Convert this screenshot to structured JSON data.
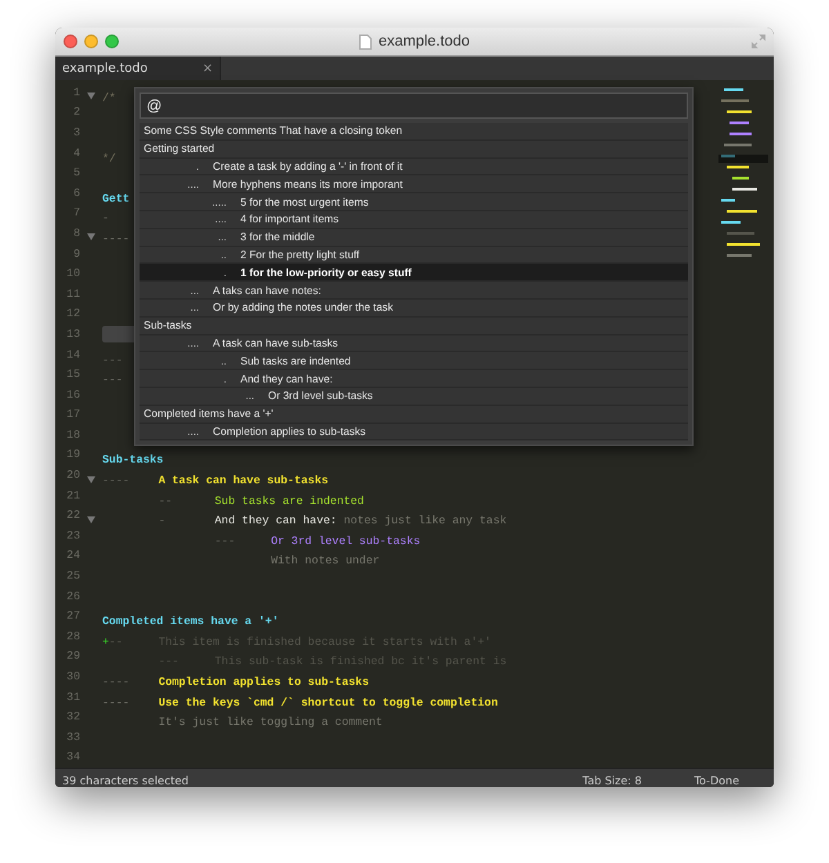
{
  "window": {
    "title": "example.todo"
  },
  "tabs": [
    {
      "label": "example.todo",
      "close": "×",
      "selected": true
    }
  ],
  "editor": {
    "lines": [
      {
        "number": "1",
        "fold": true,
        "current": false,
        "segments": [
          {
            "kind": "comment",
            "text": "/*"
          }
        ]
      },
      {
        "number": "2",
        "fold": false,
        "current": false
      },
      {
        "number": "3",
        "fold": false,
        "current": false
      },
      {
        "number": "4",
        "fold": false,
        "current": false,
        "segments": [
          {
            "kind": "comment",
            "text": "*/"
          }
        ]
      },
      {
        "number": "5",
        "fold": false,
        "current": false
      },
      {
        "number": "6",
        "fold": false,
        "current": false,
        "segments": [
          {
            "kind": "heading",
            "text": "Gett"
          }
        ]
      },
      {
        "number": "7",
        "fold": false,
        "current": false,
        "segments": [
          {
            "kind": "dashes",
            "text": "-"
          }
        ]
      },
      {
        "number": "8",
        "fold": true,
        "current": false,
        "segments": [
          {
            "kind": "dashes",
            "text": "----"
          }
        ]
      },
      {
        "number": "9",
        "fold": false,
        "current": false
      },
      {
        "number": "10",
        "fold": false,
        "current": false
      },
      {
        "number": "11",
        "fold": false,
        "current": false
      },
      {
        "number": "12",
        "fold": false,
        "current": false
      },
      {
        "number": "13",
        "fold": false,
        "current": true
      },
      {
        "number": "14",
        "fold": false,
        "current": false,
        "segments": [
          {
            "kind": "dashes",
            "text": "---"
          }
        ]
      },
      {
        "number": "15",
        "fold": false,
        "current": false,
        "segments": [
          {
            "kind": "dashes",
            "text": "---"
          }
        ]
      },
      {
        "number": "16",
        "fold": false,
        "current": false
      },
      {
        "number": "17",
        "fold": false,
        "current": false
      },
      {
        "number": "18",
        "fold": false,
        "current": false
      },
      {
        "number": "19",
        "fold": false,
        "current": false,
        "segments": [
          {
            "kind": "heading",
            "text": "Sub-tasks"
          }
        ]
      },
      {
        "number": "20",
        "fold": true,
        "current": false,
        "segments": [
          {
            "kind": "dashes",
            "text": "----\t"
          },
          {
            "kind": "urgent",
            "text": "A task can have sub-tasks"
          }
        ]
      },
      {
        "number": "21",
        "fold": false,
        "current": false,
        "segments": [
          {
            "kind": "dashes",
            "text": "\t--\t"
          },
          {
            "kind": "light",
            "text": "Sub tasks are indented"
          }
        ]
      },
      {
        "number": "22",
        "fold": true,
        "current": false,
        "segments": [
          {
            "kind": "dashes",
            "text": "\t-\t"
          },
          {
            "kind": "task",
            "text": "And they can have:"
          },
          {
            "kind": "note",
            "text": " notes just like any task"
          }
        ]
      },
      {
        "number": "23",
        "fold": false,
        "current": false,
        "segments": [
          {
            "kind": "dashes",
            "text": "\t\t---\t"
          },
          {
            "kind": "middle",
            "text": "Or 3rd level sub-tasks"
          }
        ]
      },
      {
        "number": "24",
        "fold": false,
        "current": false,
        "segments": [
          {
            "kind": "note",
            "text": "\t\t\tWith notes under"
          }
        ]
      },
      {
        "number": "25",
        "fold": false,
        "current": false
      },
      {
        "number": "26",
        "fold": false,
        "current": false
      },
      {
        "number": "27",
        "fold": false,
        "current": false,
        "segments": [
          {
            "kind": "heading",
            "text": "Completed items have a '+'"
          }
        ]
      },
      {
        "number": "28",
        "fold": false,
        "current": false,
        "segments": [
          {
            "kind": "plus",
            "text": "+"
          },
          {
            "kind": "done",
            "text": "--\tThis item is finished because it starts with a'+'"
          }
        ]
      },
      {
        "number": "29",
        "fold": false,
        "current": false,
        "segments": [
          {
            "kind": "done",
            "text": "\t---\tThis sub-task is finished bc it's parent is"
          }
        ]
      },
      {
        "number": "30",
        "fold": false,
        "current": false,
        "segments": [
          {
            "kind": "dashes",
            "text": "----\t"
          },
          {
            "kind": "urgent",
            "text": "Completion applies to sub-tasks"
          }
        ]
      },
      {
        "number": "31",
        "fold": false,
        "current": false,
        "segments": [
          {
            "kind": "dashes",
            "text": "----\t"
          },
          {
            "kind": "urgent",
            "text": "Use the keys `cmd /` shortcut to toggle completion"
          }
        ]
      },
      {
        "number": "32",
        "fold": false,
        "current": false,
        "segments": [
          {
            "kind": "note",
            "text": "\tIt's just like toggling a comment"
          }
        ]
      },
      {
        "number": "33",
        "fold": false,
        "current": false
      },
      {
        "number": "34",
        "fold": false,
        "current": false
      }
    ]
  },
  "goto_symbol": {
    "query": "@",
    "items": [
      {
        "text": "Some CSS Style comments That have a closing token",
        "selected": false
      },
      {
        "text": "Getting started",
        "selected": false,
        "children": [
          {
            "marker": ".",
            "text": "Create a task by adding a '-' in front of it",
            "selected": false
          },
          {
            "marker": "....",
            "text": "More hyphens means its more imporant",
            "selected": false,
            "children": [
              {
                "marker": ".....",
                "text": "5 for the most urgent items",
                "selected": false
              },
              {
                "marker": "....",
                "text": "4 for important items",
                "selected": false
              },
              {
                "marker": "...",
                "text": "3 for the middle",
                "selected": false
              },
              {
                "marker": "..",
                "text": "2 For the pretty light stuff",
                "selected": false
              },
              {
                "marker": ".",
                "text": "1 for the low-priority or easy stuff",
                "selected": true
              }
            ]
          },
          {
            "marker": "...",
            "text": "A taks can have notes:",
            "selected": false
          },
          {
            "marker": "...",
            "text": "Or by adding the notes under the task",
            "selected": false
          }
        ]
      },
      {
        "text": "Sub-tasks",
        "selected": false,
        "children": [
          {
            "marker": "....",
            "text": "A task can have sub-tasks",
            "selected": false,
            "children": [
              {
                "marker": "..",
                "text": "Sub tasks are indented",
                "selected": false
              },
              {
                "marker": ".",
                "text": "And they can have:",
                "selected": false,
                "children": [
                  {
                    "marker": "...",
                    "text": "Or 3rd level sub-tasks",
                    "selected": false
                  }
                ]
              }
            ]
          }
        ]
      },
      {
        "text": "Completed items have a '+'",
        "selected": false,
        "children": [
          {
            "marker": "....",
            "text": "Completion applies to sub-tasks",
            "selected": false
          }
        ]
      }
    ]
  },
  "status_bar": {
    "selection": "39 characters selected",
    "tab_size": "Tab Size: 8",
    "syntax": "To-Done"
  }
}
